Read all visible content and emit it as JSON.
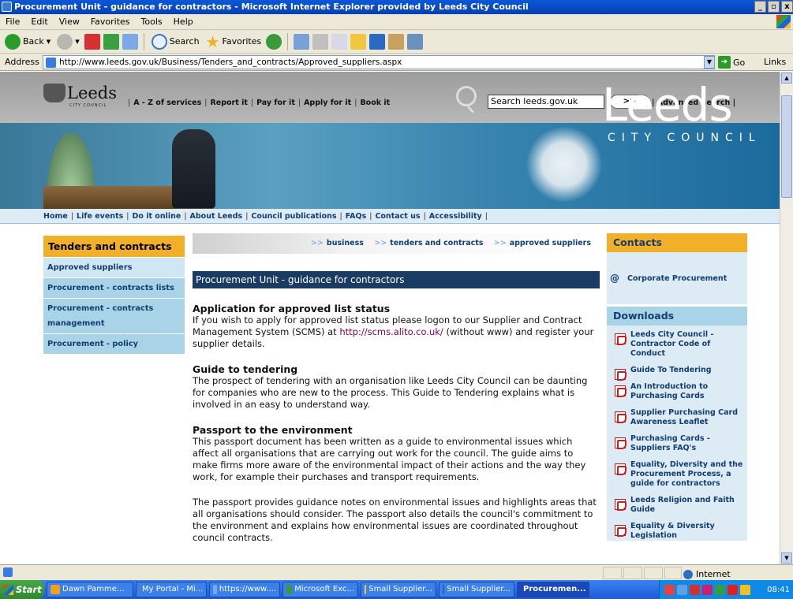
{
  "window": {
    "title": "Procurement Unit - guidance for contractors - Microsoft Internet Explorer provided by Leeds City Council",
    "controls": [
      "_",
      " ",
      "x"
    ]
  },
  "menubar": [
    "File",
    "Edit",
    "View",
    "Favorites",
    "Tools",
    "Help"
  ],
  "toolbar": {
    "back_label": "Back",
    "search_label": "Search",
    "favorites_label": "Favorites"
  },
  "address": {
    "label": "Address",
    "url": "http://www.leeds.gov.uk/Business/Tenders_and_contracts/Approved_suppliers.aspx",
    "go_label": "Go",
    "links_label": "Links"
  },
  "site": {
    "logo_text": "Leeds",
    "logo_sub": "CITY COUNCIL",
    "top_links": [
      "A - Z of services",
      "Report it",
      "Pay for it",
      "Apply for it",
      "Book it"
    ],
    "search_value": "Search leeds.gov.uk",
    "search_go": ">>",
    "advanced_search": "Advanced Search",
    "banner_word": "Leeds",
    "banner_sub": "CITY COUNCIL",
    "nav": [
      "Home",
      "Life events",
      "Do it online",
      "About Leeds",
      "Council publications",
      "FAQs",
      "Contact us",
      "Accessibility"
    ]
  },
  "leftnav": {
    "header": "Tenders and contracts",
    "items": [
      "Approved suppliers",
      "Procurement - contracts lists",
      "Procurement - contracts management",
      "Procurement - policy"
    ]
  },
  "breadcrumb": [
    "business",
    "tenders and contracts",
    "approved suppliers"
  ],
  "page_title": "Procurement Unit - guidance for contractors",
  "sections": [
    {
      "heading": "Application for approved list status",
      "text_before": "If you wish to apply for approved list status please logon to our Supplier and Contract Management System (SCMS) at ",
      "link": "http://scms.alito.co.uk/",
      "text_after": " (without www) and register your supplier details."
    },
    {
      "heading": "Guide to tendering",
      "text": "The prospect of tendering with an organisation like Leeds City Council can be daunting for companies who are new to the process. This Guide to Tendering explains what is involved in an easy to understand way."
    },
    {
      "heading": "Passport to the environment",
      "text": "This passport document has been written as a guide to environmental issues which affect all organisations that are carrying out work for the council. The guide aims to make firms more aware of the environmental impact of their actions and the way they work, for example their purchases and transport requirements."
    },
    {
      "heading": "",
      "text": "The passport provides guidance notes on environmental issues and highlights areas that all organisations should consider. The passport also details the council's commitment to the environment and explains how environmental issues are coordinated throughout council contracts."
    }
  ],
  "contacts": {
    "header": "Contacts",
    "at_symbol": "@",
    "item": "Corporate Procurement"
  },
  "downloads": {
    "header": "Downloads",
    "items": [
      "Leeds City Council - Contractor Code of Conduct",
      "Guide To Tendering",
      "An Introduction to Purchasing Cards",
      "Supplier Purchasing Card Awareness Leaflet",
      "Purchasing Cards - Suppliers FAQ's",
      "Equality, Diversity and the Procurement Process, a guide for contractors",
      "Leeds Religion and Faith Guide",
      "Equality & Diversity Legislation"
    ]
  },
  "statusbar": {
    "zone": "Internet"
  },
  "taskbar": {
    "start": "Start",
    "tasks": [
      "Dawn Pamme...",
      "My Portal - Mi...",
      "https://www....",
      "Microsoft Exc...",
      "Small Supplier...",
      "Small Supplier...",
      "Procuremen..."
    ],
    "clock": "08:41"
  },
  "colors": {
    "accent_orange": "#f2b02a",
    "nav_blue": "#123e70",
    "title_bar": "#0a58d8"
  }
}
